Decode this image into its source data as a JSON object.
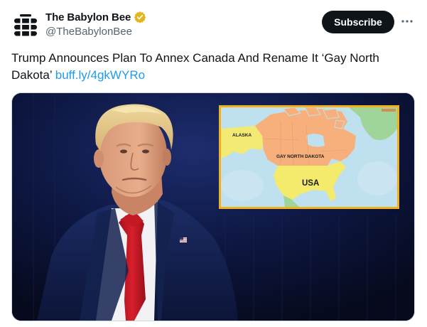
{
  "account": {
    "display_name": "The Babylon Bee",
    "handle": "@TheBabylonBee",
    "verified": true
  },
  "actions": {
    "subscribe_label": "Subscribe",
    "more_icon": "more-horizontal-icon"
  },
  "tweet": {
    "text": "Trump Announces Plan To Annex Canada And Rename It ‘Gay North Dakota’",
    "link": "buff.ly/4gkWYRo"
  },
  "media": {
    "map_labels": {
      "alaska": "ALASKA",
      "canada": "GAY NORTH DAKOTA",
      "usa": "USA"
    }
  },
  "colors": {
    "link": "#1d9bf0",
    "button_bg": "#0f1419",
    "verified_gold": "#e2b719",
    "map_frame": "#f1b01c"
  }
}
